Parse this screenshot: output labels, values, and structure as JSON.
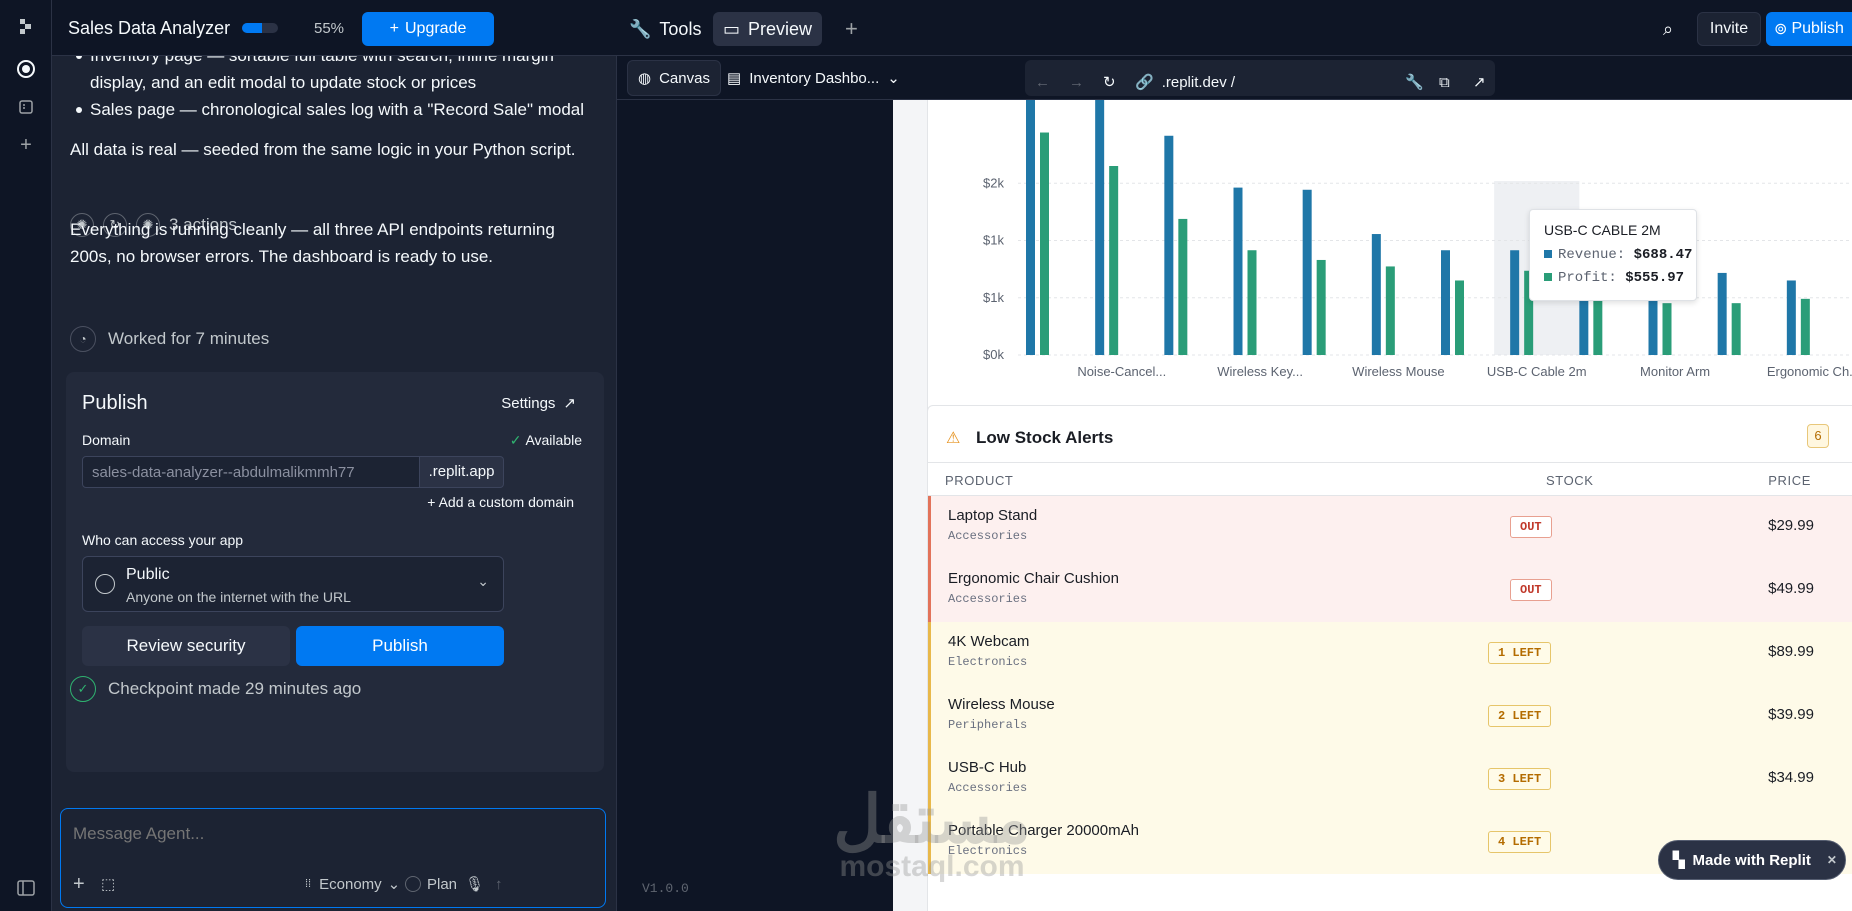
{
  "chat": {
    "app_title": "Sales Data Analyzer",
    "usage_percent": 55,
    "usage_label": "55%",
    "upgrade_label": "Upgrade",
    "bullets": [
      "Inventory page — sortable full table with search, inline margin display, and an edit modal to update stock or prices",
      "Sales page — chronological sales log with a \"Record Sale\" modal"
    ],
    "para1": "All data is real — seeded from the same logic in your Python script.",
    "actions_label": "3 actions",
    "para2": "Everything is running cleanly — all three API endpoints returning 200s, no browser errors. The dashboard is ready to use.",
    "worked_label": "Worked for 7 minutes",
    "checkpoint_label": "Checkpoint made 29 minutes ago",
    "message_placeholder": "Message Agent...",
    "economy_label": "Economy",
    "plan_label": "Plan"
  },
  "publish": {
    "title": "Publish",
    "settings_label": "Settings",
    "domain_label": "Domain",
    "available_label": "Available",
    "domain_value": "sales-data-analyzer--abdulmalikmmh77",
    "domain_suffix": ".replit.app",
    "custom_domain_label": "Add a custom domain",
    "access_label": "Who can access your app",
    "access_title": "Public",
    "access_sub": "Anyone on the internet with the URL",
    "review_label": "Review security",
    "publish_label": "Publish"
  },
  "topbar": {
    "tools_label": "Tools",
    "preview_label": "Preview",
    "invite_label": "Invite",
    "publish_label": "Publish",
    "canvas_label": "Canvas",
    "page_label": "Inventory Dashbo...",
    "url": ".replit.dev /"
  },
  "version": "V1.0.0",
  "chart_data": {
    "type": "bar",
    "categories": [
      "",
      "Noise-Cancel...",
      "",
      "Wireless Key...",
      "",
      "Wireless Mouse",
      "",
      "USB-C Cable 2m",
      "",
      "Monitor Arm",
      "",
      "Ergonomic Ch..."
    ],
    "series": [
      {
        "name": "Revenue",
        "color": "#1f77a8",
        "values": [
          3300,
          2950,
          2030,
          1550,
          1530,
          1120,
          970,
          970,
          930,
          760,
          760,
          690
        ]
      },
      {
        "name": "Profit",
        "color": "#2a9d78",
        "values": [
          2060,
          1750,
          1260,
          970,
          880,
          820,
          690,
          780,
          610,
          480,
          480,
          520
        ]
      }
    ],
    "ytick_labels": [
      "$0k",
      "$1k",
      "$1k",
      "$2k"
    ],
    "legend": "bottom-center",
    "grid": true,
    "tooltip": {
      "title": "USB-C CABLE 2M",
      "revenue_label": "Revenue:",
      "revenue_value": "$688.47",
      "profit_label": "Profit:",
      "profit_value": "$555.97"
    }
  },
  "alerts": {
    "title": "Low Stock Alerts",
    "count": "6",
    "headers": {
      "product": "PRODUCT",
      "stock": "STOCK",
      "price": "PRICE"
    },
    "rows": [
      {
        "name": "Laptop Stand",
        "category": "Accessories",
        "stock": "OUT",
        "price": "$29.99",
        "level": "red"
      },
      {
        "name": "Ergonomic Chair Cushion",
        "category": "Accessories",
        "stock": "OUT",
        "price": "$49.99",
        "level": "red"
      },
      {
        "name": "4K Webcam",
        "category": "Electronics",
        "stock": "1 LEFT",
        "price": "$89.99",
        "level": "yel"
      },
      {
        "name": "Wireless Mouse",
        "category": "Peripherals",
        "stock": "2 LEFT",
        "price": "$39.99",
        "level": "yel"
      },
      {
        "name": "USB-C Hub",
        "category": "Accessories",
        "stock": "3 LEFT",
        "price": "$34.99",
        "level": "yel"
      },
      {
        "name": "Portable Charger 20000mAh",
        "category": "Electronics",
        "stock": "4 LEFT",
        "price": "",
        "level": "yel"
      }
    ]
  },
  "made_with": "Made with Replit",
  "watermark": {
    "ar": "مستقل",
    "en": "mostaql.com"
  }
}
